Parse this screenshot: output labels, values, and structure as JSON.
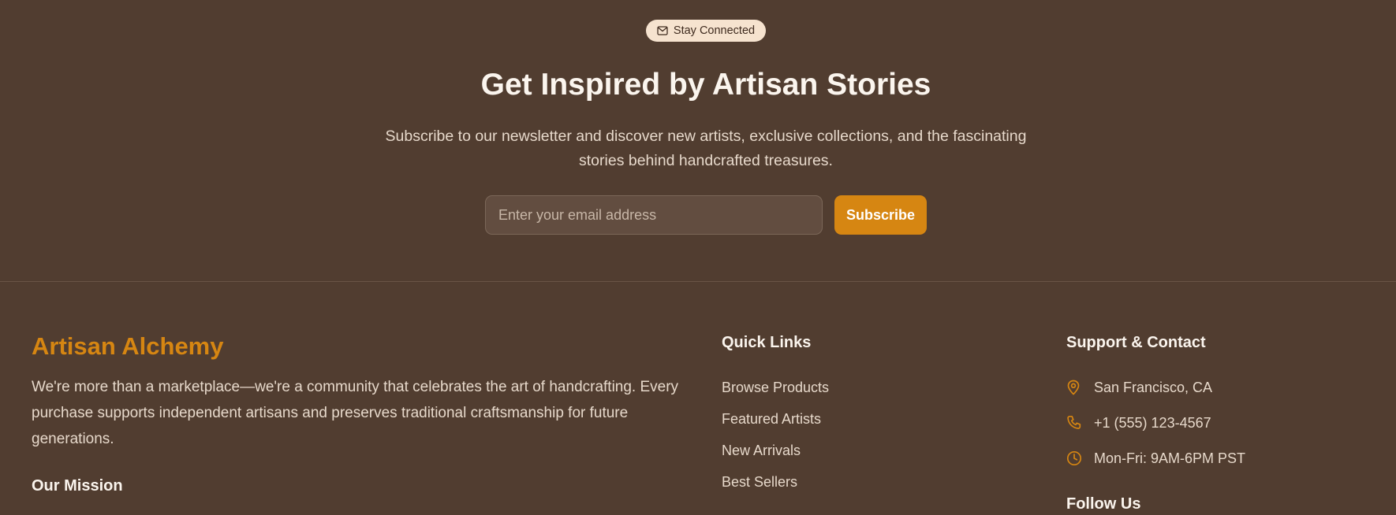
{
  "newsletter": {
    "badge_icon": "mail-icon",
    "badge_label": "Stay Connected",
    "headline": "Get Inspired by Artisan Stories",
    "subtext": "Subscribe to our newsletter and discover new artists, exclusive collections, and the fascinating stories behind handcrafted treasures.",
    "email_placeholder": "Enter your email address",
    "email_value": "",
    "subscribe_label": "Subscribe"
  },
  "footer": {
    "brand": {
      "name": "Artisan Alchemy",
      "description": "We're more than a marketplace—we're a community that celebrates the art of handcrafting. Every purchase supports independent artisans and preserves traditional craftsmanship for future generations.",
      "mission_heading": "Our Mission"
    },
    "quick_links": {
      "heading": "Quick Links",
      "items": [
        {
          "label": "Browse Products"
        },
        {
          "label": "Featured Artists"
        },
        {
          "label": "New Arrivals"
        },
        {
          "label": "Best Sellers"
        }
      ]
    },
    "support": {
      "heading": "Support & Contact",
      "items": [
        {
          "icon": "map-pin-icon",
          "label": "San Francisco, CA"
        },
        {
          "icon": "phone-icon",
          "label": "+1 (555) 123-4567"
        },
        {
          "icon": "clock-icon",
          "label": "Mon-Fri: 9AM-6PM PST"
        }
      ],
      "follow_heading": "Follow Us"
    }
  },
  "colors": {
    "background": "#513d30",
    "accent": "#d68612",
    "badge_bg": "#f6e3cf",
    "heading_text": "#fbf5ee",
    "body_text": "#e7d9cb"
  }
}
